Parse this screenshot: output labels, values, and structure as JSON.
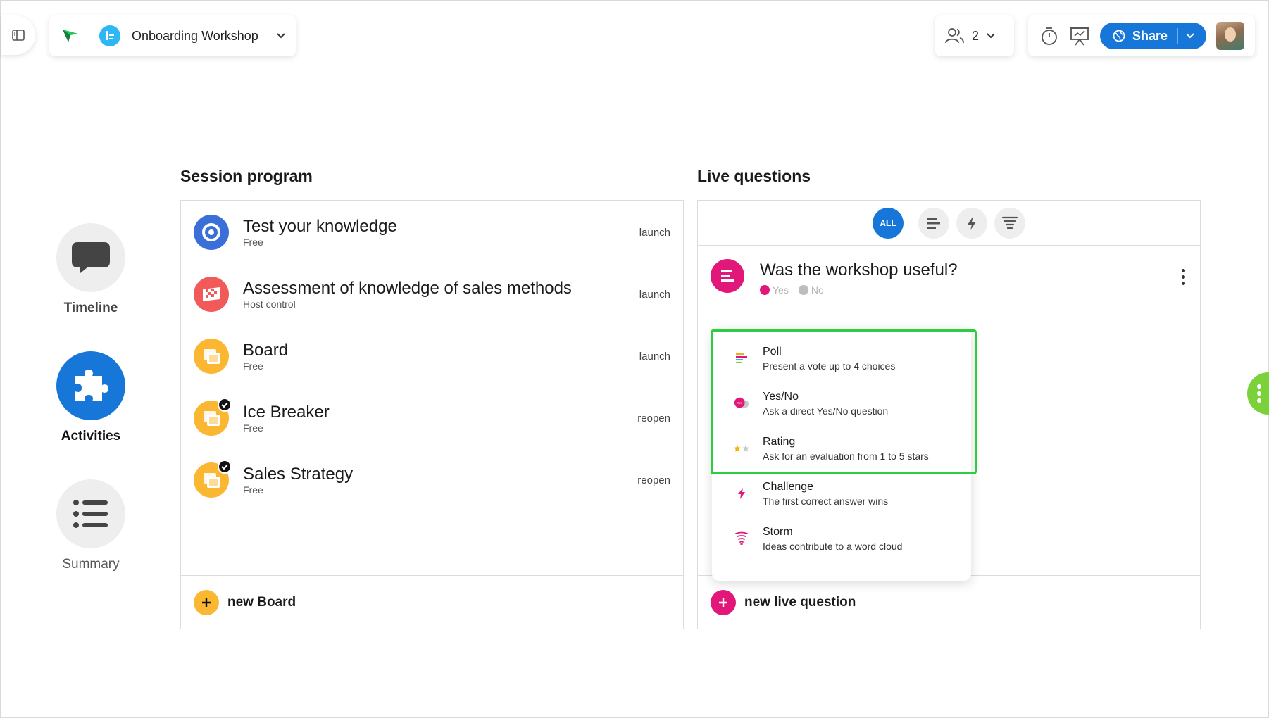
{
  "header": {
    "workshop_title": "Onboarding Workshop",
    "participants_count": "2",
    "share_label": "Share"
  },
  "nav": {
    "items": [
      {
        "label": "Timeline",
        "icon": "speech-bubble-icon"
      },
      {
        "label": "Activities",
        "icon": "puzzle-icon"
      },
      {
        "label": "Summary",
        "icon": "list-icon"
      }
    ]
  },
  "session_program": {
    "title": "Session program",
    "items": [
      {
        "title": "Test your knowledge",
        "sub": "Free",
        "action": "launch",
        "color": "#3a6fd8"
      },
      {
        "title": "Assessment of knowledge of sales methods",
        "sub": "Host control",
        "action": "launch",
        "color": "#f25a5a"
      },
      {
        "title": "Board",
        "sub": "Free",
        "action": "launch",
        "color": "#fbb731"
      },
      {
        "title": "Ice Breaker",
        "sub": "Free",
        "action": "reopen",
        "color": "#fbb731"
      },
      {
        "title": "Sales Strategy",
        "sub": "Free",
        "action": "reopen",
        "color": "#fbb731"
      }
    ],
    "footer_label": "new Board"
  },
  "live_questions": {
    "title": "Live questions",
    "filters": {
      "all_label": "ALL"
    },
    "question": {
      "title": "Was the workshop useful?",
      "options": [
        "Yes",
        "No"
      ]
    },
    "footer_label": "new live question"
  },
  "dropdown": {
    "items": [
      {
        "title": "Poll",
        "desc": "Present a vote up to 4 choices"
      },
      {
        "title": "Yes/No",
        "desc": "Ask a direct Yes/No question",
        "icon_text": "Yes"
      },
      {
        "title": "Rating",
        "desc": "Ask for an evaluation from 1 to 5 stars"
      },
      {
        "title": "Challenge",
        "desc": "The first correct answer wins"
      },
      {
        "title": "Storm",
        "desc": "Ideas contribute to a word cloud"
      }
    ]
  },
  "colors": {
    "accent": "#1677d9",
    "pink": "#e2177a",
    "highlight": "#2ecc40",
    "green_handle": "#7bd13a",
    "yellow": "#fbb731"
  }
}
